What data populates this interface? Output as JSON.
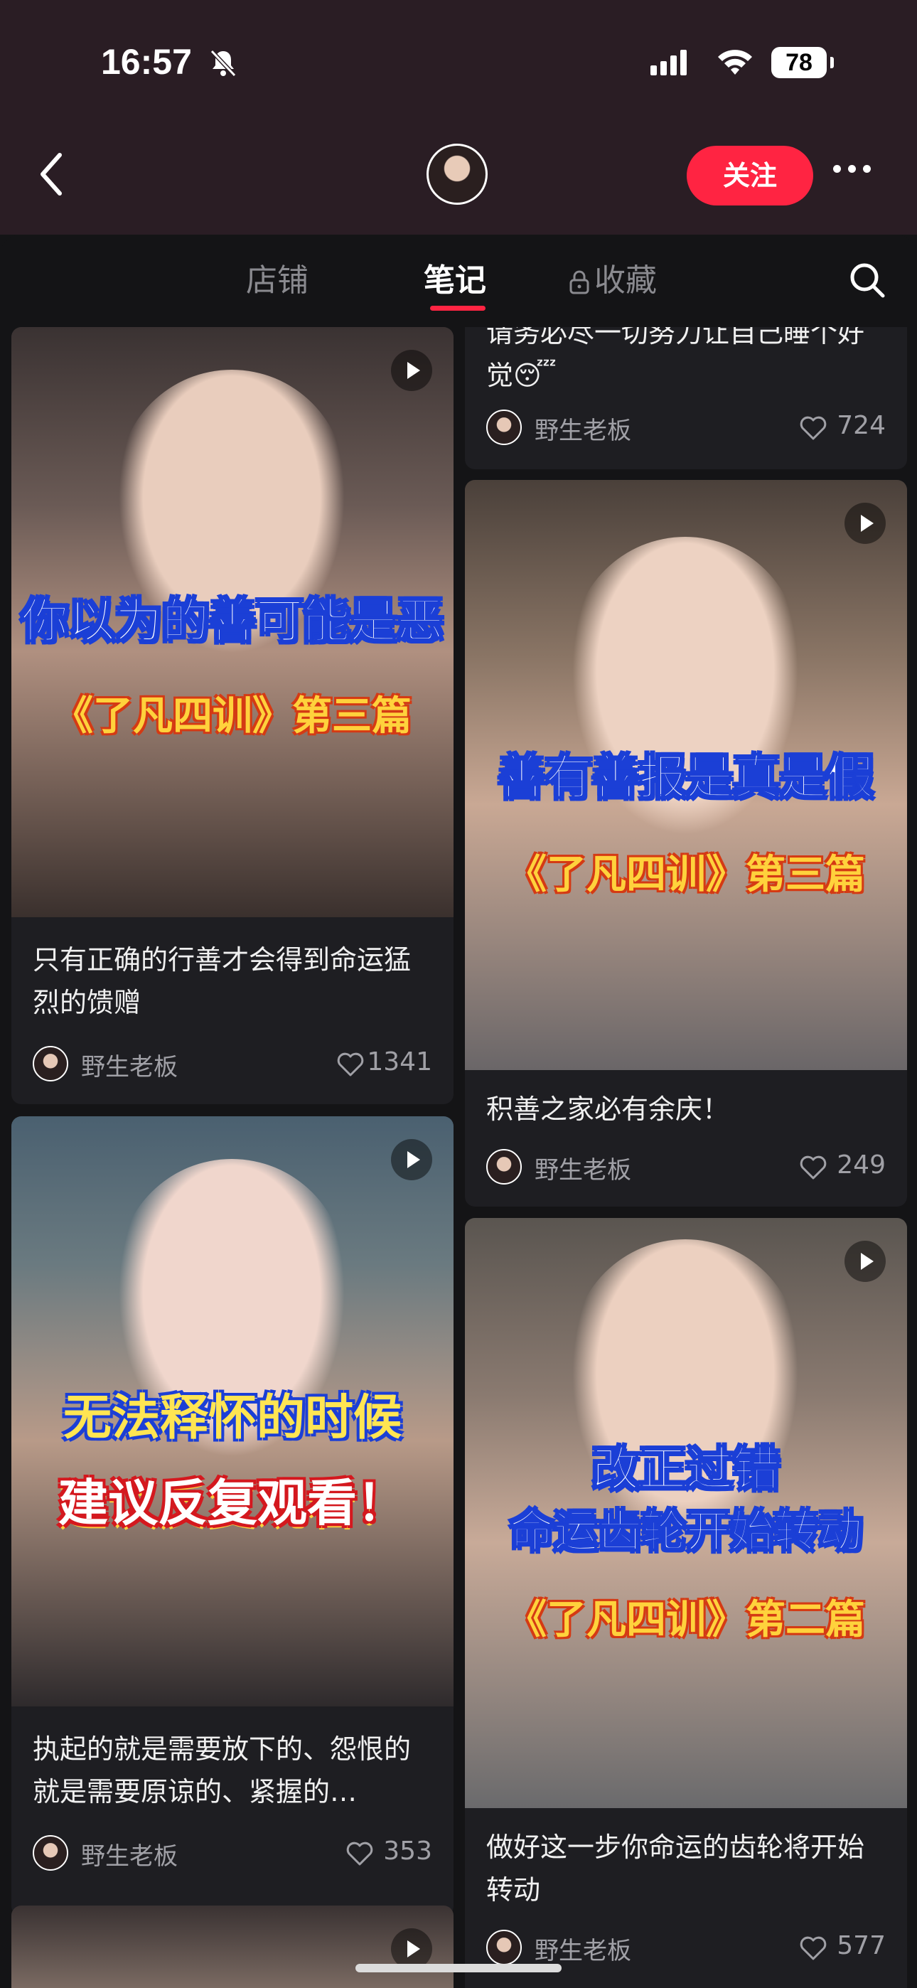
{
  "status_bar": {
    "time": "16:57",
    "battery": "78"
  },
  "header": {
    "follow_label": "关注"
  },
  "tabs": [
    {
      "label": "店铺",
      "active": false
    },
    {
      "label": "笔记",
      "active": true
    },
    {
      "label": "收藏",
      "active": false,
      "locked": true
    }
  ],
  "cards": [
    {
      "overlay_lines": [
        "你以为的善可能是恶",
        "《了凡四训》第三篇"
      ],
      "title": "只有正确的行善才会得到命运猛烈的馈赠",
      "author": "野生老板",
      "likes": "1341"
    },
    {
      "title_partial": "请务必尽一切努力让自己睡个好觉😴",
      "author": "野生老板",
      "likes": "724"
    },
    {
      "overlay_lines": [
        "善有善报是真是假",
        "《了凡四训》第三篇"
      ],
      "title": "积善之家必有余庆！",
      "author": "野生老板",
      "likes": "249"
    },
    {
      "overlay_lines": [
        "无法释怀的时候",
        "建议反复观看！"
      ],
      "title": "执起的就是需要放下的、怨恨的就是需要原谅的、紧握的…",
      "author": "野生老板",
      "likes": "353"
    },
    {
      "overlay_lines": [
        "改正过错",
        "命运齿轮开始转动",
        "《了凡四训》第二篇"
      ],
      "title": "做好这一步你命运的齿轮将开始转动",
      "author": "野生老板",
      "likes": "577"
    }
  ],
  "colors": {
    "accent": "#ff2442",
    "header_bg": "#2a1d24",
    "page_bg": "#141416"
  }
}
